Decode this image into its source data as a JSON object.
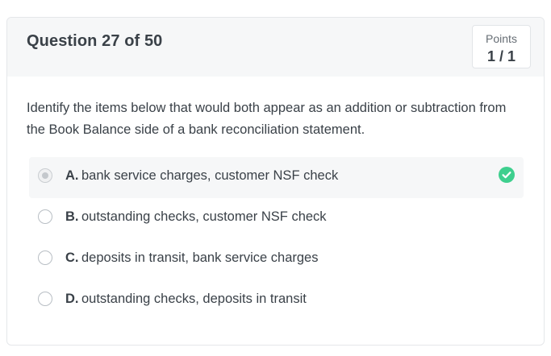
{
  "header": {
    "title": "Question 27 of 50",
    "points_label": "Points",
    "points_value": "1 / 1"
  },
  "question": {
    "prompt": "Identify the items below that would both appear as an addition or subtraction from the Book Balance side of a bank reconciliation statement."
  },
  "options": [
    {
      "letter": "A.",
      "text": "bank service charges, customer NSF check",
      "selected": true,
      "correct": true
    },
    {
      "letter": "B.",
      "text": "outstanding checks, customer NSF check",
      "selected": false,
      "correct": false
    },
    {
      "letter": "C.",
      "text": "deposits in transit, bank service charges",
      "selected": false,
      "correct": false
    },
    {
      "letter": "D.",
      "text": "outstanding checks, deposits in transit",
      "selected": false,
      "correct": false
    }
  ],
  "colors": {
    "correct": "#3ecf8e",
    "header_bg": "#f6f7f8",
    "text": "#3a4148"
  },
  "icons": {
    "correct_marker": "check-circle-icon"
  }
}
